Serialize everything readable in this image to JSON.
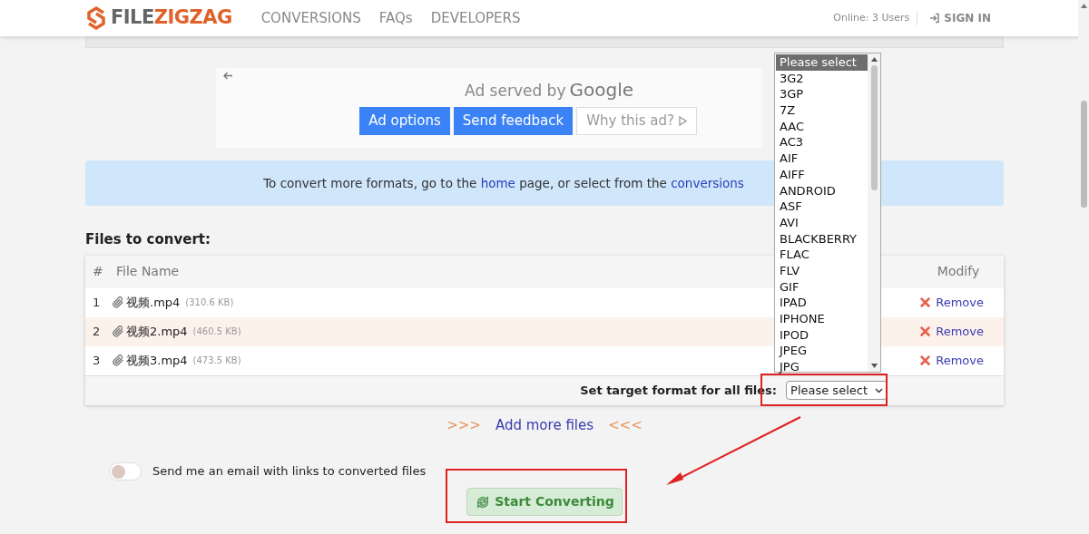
{
  "header": {
    "brand_prefix": "FILE",
    "brand_suffix": "ZIGZAG",
    "nav": [
      "CONVERSIONS",
      "FAQs",
      "DEVELOPERS"
    ],
    "online": "Online: 3 Users",
    "sign_in": "SIGN IN"
  },
  "ad": {
    "served_by": "Ad served by",
    "google": "Google",
    "buttons": [
      {
        "kind": "primary",
        "label": "Ad options"
      },
      {
        "kind": "primary",
        "label": "Send feedback"
      },
      {
        "kind": "plain",
        "label": "Why this ad?"
      }
    ]
  },
  "info": [
    {
      "kind": "text",
      "text": "To convert more formats, go to the "
    },
    {
      "kind": "link",
      "text": "home"
    },
    {
      "kind": "text",
      "text": " page, or select from the "
    },
    {
      "kind": "link",
      "text": "conversions"
    }
  ],
  "files_title": "Files to convert:",
  "table": {
    "columns": [
      "#",
      "File Name",
      "Modify"
    ],
    "rows": [
      {
        "index": "1",
        "name": "视频.mp4",
        "size": "(310.6 KB)",
        "action": "Remove",
        "selected": false
      },
      {
        "index": "2",
        "name": "视频2.mp4",
        "size": "(460.5 KB)",
        "action": "Remove",
        "selected": true
      },
      {
        "index": "3",
        "name": "视频3.mp4",
        "size": "(473.5 KB)",
        "action": "Remove",
        "selected": false
      }
    ],
    "footer_label": "Set target format for all files:",
    "select_value": "Please select"
  },
  "dropdown": [
    {
      "label": "Please select",
      "selected": true
    },
    {
      "label": "3G2",
      "selected": false
    },
    {
      "label": "3GP",
      "selected": false
    },
    {
      "label": "7Z",
      "selected": false
    },
    {
      "label": "AAC",
      "selected": false
    },
    {
      "label": "AC3",
      "selected": false
    },
    {
      "label": "AIF",
      "selected": false
    },
    {
      "label": "AIFF",
      "selected": false
    },
    {
      "label": "ANDROID",
      "selected": false
    },
    {
      "label": "ASF",
      "selected": false
    },
    {
      "label": "AVI",
      "selected": false
    },
    {
      "label": "BLACKBERRY",
      "selected": false
    },
    {
      "label": "FLAC",
      "selected": false
    },
    {
      "label": "FLV",
      "selected": false
    },
    {
      "label": "GIF",
      "selected": false
    },
    {
      "label": "IPAD",
      "selected": false
    },
    {
      "label": "IPHONE",
      "selected": false
    },
    {
      "label": "IPOD",
      "selected": false
    },
    {
      "label": "JPEG",
      "selected": false
    },
    {
      "label": "JPG",
      "selected": false
    }
  ],
  "add_more": {
    "left": ">>>",
    "label": "Add more files",
    "right": "<<<"
  },
  "email": {
    "on": false,
    "label": "Send me an email with links to converted files"
  },
  "start_button": "Start Converting"
}
